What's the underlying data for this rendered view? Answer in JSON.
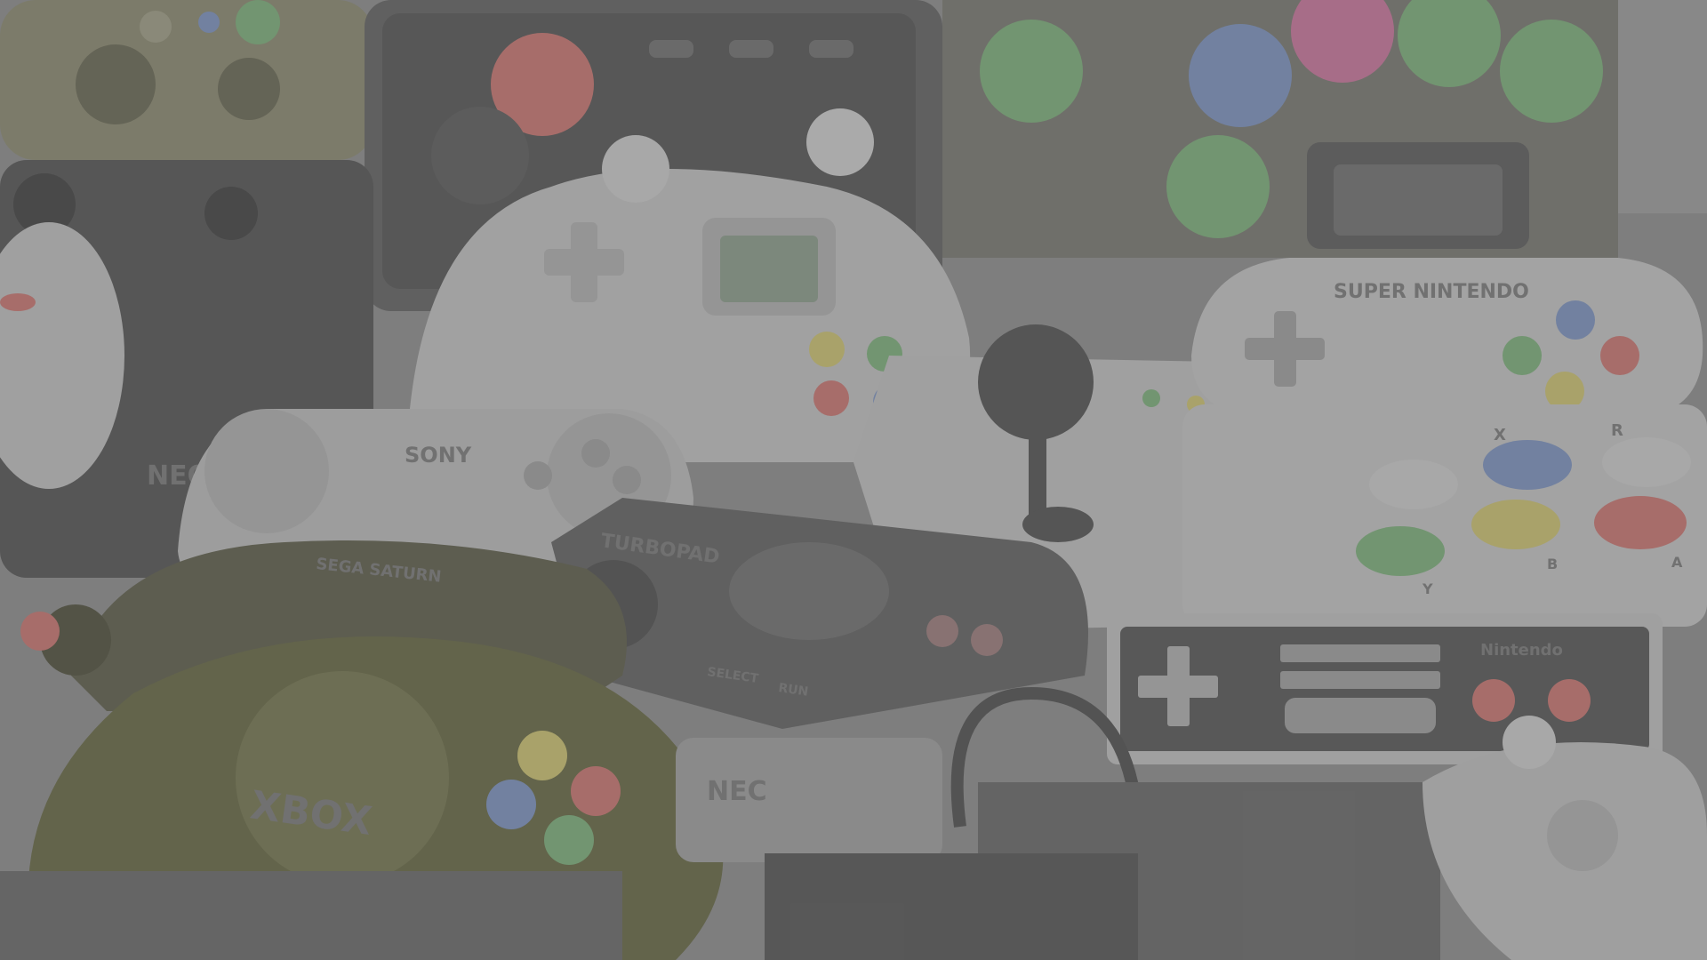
{
  "scene": {
    "labels": {
      "sega_saturn": "SEGA SATURN",
      "turbopad": "TURBOPAD",
      "select": "SELECT",
      "run": "RUN",
      "sony": "SONY",
      "neo": "NEO",
      "nintendo": "Nintendo",
      "super_nintendo": "SUPER NINTENDO",
      "xbox": "XBOX",
      "nec": "NEC",
      "btn_x": "X",
      "btn_r": "R",
      "btn_b": "B",
      "btn_a": "A",
      "btn_y": "Y"
    },
    "colors": {
      "backdrop": "#7d7d7d",
      "overlay": "#808080",
      "gray_controller": "#a9a9a9",
      "dark_controller": "#4e4e4e",
      "xbox_green": "#5d5f40",
      "button_red": "#b06a66",
      "button_blue": "#6f82a8",
      "button_green": "#6f9a6e",
      "button_yellow": "#b2aa66"
    }
  }
}
